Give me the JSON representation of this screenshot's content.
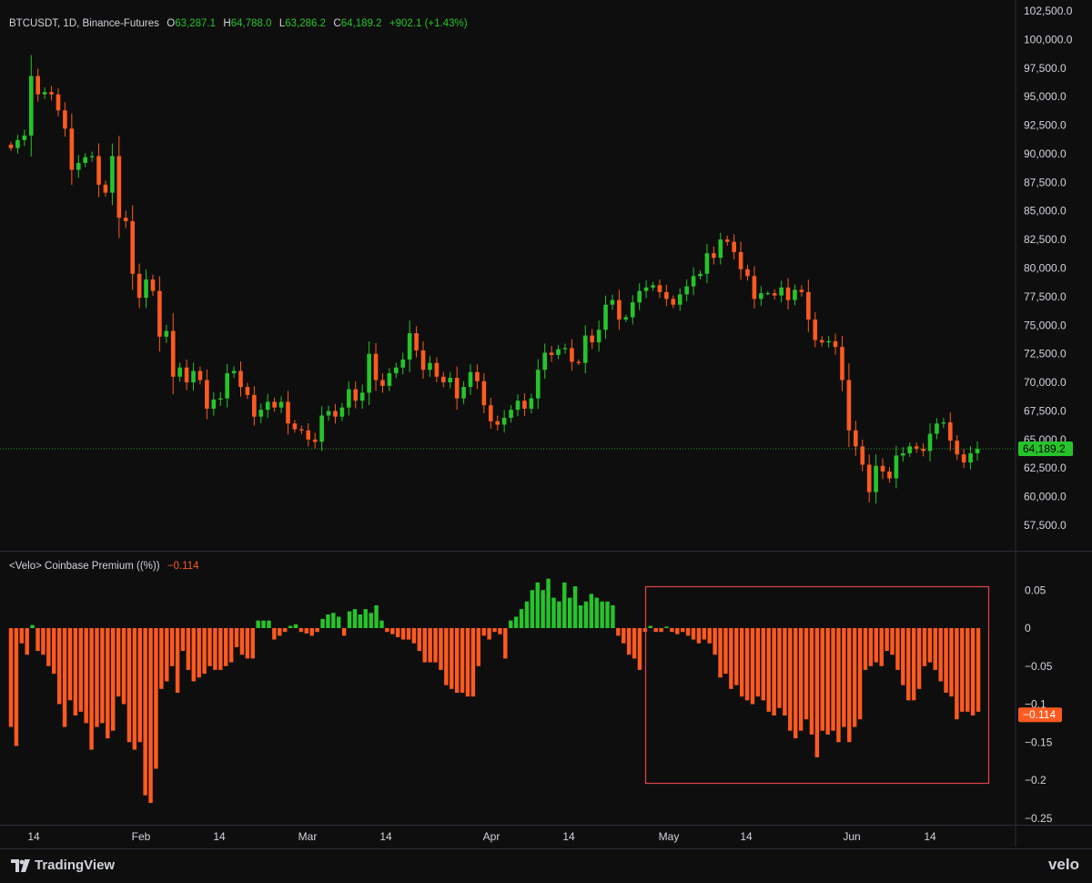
{
  "header": {
    "symbol": "BTCUSDT, 1D, Binance-Futures",
    "o_label": "O",
    "o_value": "63,287.1",
    "h_label": "H",
    "h_value": "64,788.0",
    "l_label": "L",
    "l_value": "63,286.2",
    "c_label": "C",
    "c_value": "64,189.2",
    "change": "+902.1 (+1.43%)"
  },
  "indicator": {
    "title": "<Velo> Coinbase Premium ((%))",
    "value": "−0.114"
  },
  "price_tag": "64,189.2",
  "premium_tag": "−0.114",
  "footer": {
    "brand_left": "TradingView",
    "brand_right": "velo"
  },
  "colors": {
    "up": "#26c42a",
    "down": "#ff5a1f",
    "background": "#0e0e0e",
    "highlight_box": "#e0454c"
  },
  "chart_data": [
    {
      "type": "candlestick",
      "title": "BTCUSDT, 1D, Binance-Futures",
      "ylim": [
        55500,
        102500
      ],
      "y_ticks": [
        "102,500.0",
        "100,000.0",
        "97,500.0",
        "95,000.0",
        "92,500.0",
        "90,000.0",
        "87,500.0",
        "85,000.0",
        "82,500.0",
        "80,000.0",
        "77,500.0",
        "75,000.0",
        "72,500.0",
        "70,000.0",
        "67,500.0",
        "65,000.0",
        "62,500.0",
        "60,000.0",
        "57,500.0"
      ],
      "x_ticks": [
        "14",
        "Feb",
        "14",
        "Mar",
        "14",
        "Apr",
        "14",
        "May",
        "14",
        "Jun",
        "14"
      ],
      "last_price": 64189.2,
      "closes": [
        90500,
        91200,
        91600,
        96800,
        95200,
        95400,
        95200,
        93800,
        92200,
        88600,
        89200,
        89700,
        89800,
        87300,
        86600,
        89800,
        84400,
        84100,
        79500,
        77400,
        79000,
        78000,
        74000,
        74500,
        70500,
        71300,
        70000,
        71000,
        70200,
        67700,
        68500,
        68600,
        70800,
        71000,
        69600,
        68900,
        67000,
        67600,
        68300,
        67800,
        68300,
        66400,
        65900,
        65800,
        65000,
        64800,
        67100,
        67500,
        67000,
        67800,
        69400,
        68400,
        69100,
        72500,
        70200,
        69700,
        70800,
        71300,
        72000,
        74300,
        72800,
        71100,
        71700,
        70500,
        70000,
        70400,
        68600,
        69600,
        70900,
        70100,
        68000,
        66600,
        66300,
        66900,
        67600,
        68400,
        67700,
        68600,
        71100,
        72600,
        72400,
        72900,
        73000,
        71800,
        71700,
        74100,
        73500,
        74600,
        76800,
        77200,
        75500,
        75700,
        77000,
        78000,
        78300,
        78500,
        77900,
        77300,
        76800,
        77700,
        78400,
        79300,
        79500,
        81300,
        80900,
        82500,
        82300,
        81400,
        79900,
        79300,
        77300,
        77800,
        77800,
        77600,
        78300,
        77200,
        78100,
        77900,
        75500,
        73700,
        73500,
        73600,
        73100,
        70200,
        65800,
        64400,
        62800,
        60400,
        62700,
        62200,
        61600,
        63600,
        63800,
        64400,
        64200,
        64000,
        65500,
        66400,
        66500,
        64900,
        63700,
        63000,
        63800,
        64189
      ],
      "premium_ylim": [
        -0.25,
        0.05
      ],
      "premium_y_ticks": [
        "0.05",
        "0",
        "−0.05",
        "−0.1",
        "−0.15",
        "−0.2",
        "−0.25"
      ],
      "premium_values": [
        -0.13,
        -0.155,
        -0.02,
        -0.035,
        0.004,
        -0.03,
        -0.035,
        -0.05,
        -0.06,
        -0.1,
        -0.13,
        -0.095,
        -0.115,
        -0.11,
        -0.125,
        -0.16,
        -0.13,
        -0.125,
        -0.145,
        -0.135,
        -0.09,
        -0.1,
        -0.15,
        -0.16,
        -0.15,
        -0.22,
        -0.23,
        -0.185,
        -0.08,
        -0.07,
        -0.05,
        -0.085,
        -0.03,
        -0.055,
        -0.07,
        -0.065,
        -0.06,
        -0.05,
        -0.055,
        -0.055,
        -0.05,
        -0.045,
        -0.025,
        -0.035,
        -0.04,
        -0.04,
        0.01,
        0.01,
        0.01,
        -0.015,
        -0.01,
        -0.005,
        0.003,
        0.005,
        -0.005,
        -0.007,
        -0.01,
        -0.005,
        0.012,
        0.018,
        0.02,
        0.015,
        -0.01,
        0.022,
        0.025,
        0.018,
        0.025,
        0.02,
        0.03,
        0.01,
        -0.005,
        -0.008,
        -0.012,
        -0.015,
        -0.015,
        -0.02,
        -0.03,
        -0.045,
        -0.045,
        -0.045,
        -0.055,
        -0.075,
        -0.08,
        -0.085,
        -0.085,
        -0.09,
        -0.09,
        -0.05,
        -0.01,
        -0.015,
        -0.005,
        -0.008,
        -0.04,
        0.01,
        0.015,
        0.025,
        0.035,
        0.05,
        0.06,
        0.05,
        0.065,
        0.04,
        0.035,
        0.06,
        0.04,
        0.055,
        0.03,
        0.035,
        0.045,
        0.04,
        0.035,
        0.035,
        0.03,
        -0.01,
        -0.02,
        -0.035,
        -0.04,
        -0.055,
        -0.005,
        0.003,
        -0.005,
        -0.005,
        0.002,
        -0.005,
        -0.008,
        -0.005,
        -0.01,
        -0.015,
        -0.02,
        -0.015,
        -0.02,
        -0.035,
        -0.065,
        -0.06,
        -0.08,
        -0.075,
        -0.09,
        -0.095,
        -0.1,
        -0.09,
        -0.095,
        -0.11,
        -0.115,
        -0.105,
        -0.115,
        -0.135,
        -0.145,
        -0.135,
        -0.12,
        -0.14,
        -0.17,
        -0.135,
        -0.14,
        -0.135,
        -0.15,
        -0.13,
        -0.15,
        -0.13,
        -0.12,
        -0.055,
        -0.05,
        -0.045,
        -0.05,
        -0.03,
        -0.035,
        -0.055,
        -0.075,
        -0.095,
        -0.095,
        -0.08,
        -0.05,
        -0.045,
        -0.055,
        -0.07,
        -0.085,
        -0.09,
        -0.12,
        -0.11,
        -0.11,
        -0.115,
        -0.11
      ]
    }
  ]
}
